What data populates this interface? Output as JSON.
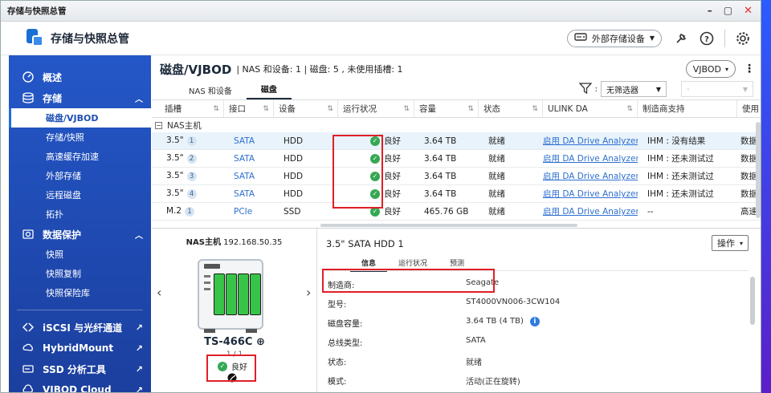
{
  "window": {
    "title": "存储与快照总管",
    "minimize": "–",
    "maximize": "▢",
    "close": "✕"
  },
  "app": {
    "title": "存储与快照总管",
    "external_button": "外部存储设备"
  },
  "sidebar": {
    "groups": [
      {
        "label": "概述",
        "icon": "dashboard-icon"
      },
      {
        "label": "存储",
        "icon": "storage-icon",
        "chevron": "︿",
        "items": [
          "磁盘/VJBOD",
          "存储/快照",
          "高速缓存加速",
          "外部存储",
          "远程磁盘",
          "拓扑"
        ]
      },
      {
        "label": "数据保护",
        "icon": "data-protection-icon",
        "chevron": "︿",
        "items": [
          "快照",
          "快照复制",
          "快照保险库"
        ]
      }
    ],
    "external": [
      {
        "label": "iSCSI 与光纤通道",
        "icon": "iscsi-icon"
      },
      {
        "label": "HybridMount",
        "icon": "hybridmount-icon"
      },
      {
        "label": "SSD 分析工具",
        "icon": "ssd-icon"
      },
      {
        "label": "VJBOD Cloud",
        "icon": "cloud-icon"
      }
    ]
  },
  "main": {
    "title": "磁盘/VJBOD",
    "meta": "| NAS 和设备: 1 | 磁盘: 5 , 未使用插槽: 1",
    "vjbod_select": "VJBOD",
    "tabs": [
      "NAS 和设备",
      "磁盘"
    ],
    "filter": {
      "value": "无筛选器",
      "second": "-"
    }
  },
  "table": {
    "headers": [
      "插槽",
      "接口",
      "设备",
      "运行状况",
      "容量",
      "状态",
      "ULINK DA",
      "制造商支持",
      "使用"
    ],
    "group": "NAS主机",
    "rows": [
      {
        "slot": "3.5\"",
        "num": "1",
        "iface": "SATA",
        "dev": "HDD",
        "health": "良好",
        "cap": "3.64 TB",
        "state": "就绪",
        "ulink": "启用 DA Drive Analyzer",
        "support": "IHM : 没有结果",
        "use": "数据"
      },
      {
        "slot": "3.5\"",
        "num": "2",
        "iface": "SATA",
        "dev": "HDD",
        "health": "良好",
        "cap": "3.64 TB",
        "state": "就绪",
        "ulink": "启用 DA Drive Analyzer",
        "support": "IHM : 还未测试过",
        "use": "数据"
      },
      {
        "slot": "3.5\"",
        "num": "3",
        "iface": "SATA",
        "dev": "HDD",
        "health": "良好",
        "cap": "3.64 TB",
        "state": "就绪",
        "ulink": "启用 DA Drive Analyzer",
        "support": "IHM : 还未测试过",
        "use": "数据"
      },
      {
        "slot": "3.5\"",
        "num": "4",
        "iface": "SATA",
        "dev": "HDD",
        "health": "良好",
        "cap": "3.64 TB",
        "state": "就绪",
        "ulink": "启用 DA Drive Analyzer",
        "support": "IHM : 还未测试过",
        "use": "数据"
      },
      {
        "slot": "M.2",
        "num": "1",
        "iface": "PCIe",
        "dev": "SSD",
        "health": "良好",
        "cap": "465.76 GB",
        "state": "就绪",
        "ulink": "启用 DA Drive Analyzer",
        "support": "--",
        "use": "高速"
      }
    ]
  },
  "nas": {
    "label": "NAS主机",
    "ip": "192.168.50.35",
    "model": "TS-466C",
    "page": "1 / 1",
    "status": "良好"
  },
  "detail": {
    "title": "3.5\" SATA HDD 1",
    "op_button": "操作",
    "tabs": [
      "信息",
      "运行状况",
      "预测"
    ],
    "fields": [
      {
        "k": "制造商:",
        "v": "Seagate"
      },
      {
        "k": "型号:",
        "v": "ST4000VN006-3CW104"
      },
      {
        "k": "磁盘容量:",
        "v": "3.64 TB (4 TB)"
      },
      {
        "k": "总线类型:",
        "v": "SATA"
      },
      {
        "k": "状态:",
        "v": "就绪"
      },
      {
        "k": "模式:",
        "v": "活动(正在旋转)"
      }
    ]
  }
}
